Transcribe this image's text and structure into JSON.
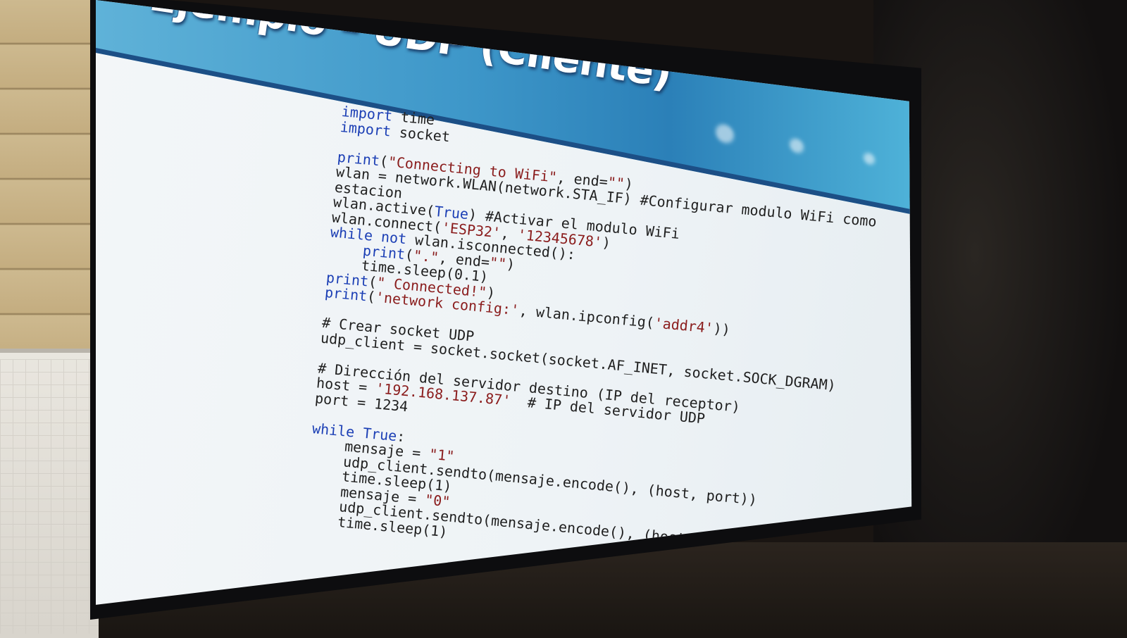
{
  "slide": {
    "title": "Ejemplo – UDP (Cliente)"
  },
  "code": {
    "lines": [
      "import time",
      "import socket",
      "",
      "print(\"Connecting to WiFi\", end=\"\")",
      "wlan = network.WLAN(network.STA_IF) #Configurar modulo WiFi como",
      "estacion",
      "wlan.active(True) #Activar el modulo WiFi",
      "wlan.connect('ESP32', '12345678')",
      "while not wlan.isconnected():",
      "    print(\".\", end=\"\")",
      "    time.sleep(0.1)",
      "print(\" Connected!\")",
      "print('network config:', wlan.ipconfig('addr4'))",
      "",
      "# Crear socket UDP",
      "udp_client = socket.socket(socket.AF_INET, socket.SOCK_DGRAM)",
      "",
      "# Dirección del servidor destino (IP del receptor)",
      "host = '192.168.137.87'  # IP del servidor UDP",
      "port = 1234",
      "",
      "while True:",
      "    mensaje = \"1\"",
      "    udp_client.sendto(mensaje.encode(), (host, port))",
      "    time.sleep(1)",
      "    mensaje = \"0\"",
      "    udp_client.sendto(mensaje.encode(), (host, port))",
      "    time.sleep(1)"
    ]
  },
  "colors": {
    "keyword": "#1c3fb5",
    "string": "#8a1c1c",
    "banner": "#3e97c9",
    "screen_bg": "#eef3f6"
  }
}
